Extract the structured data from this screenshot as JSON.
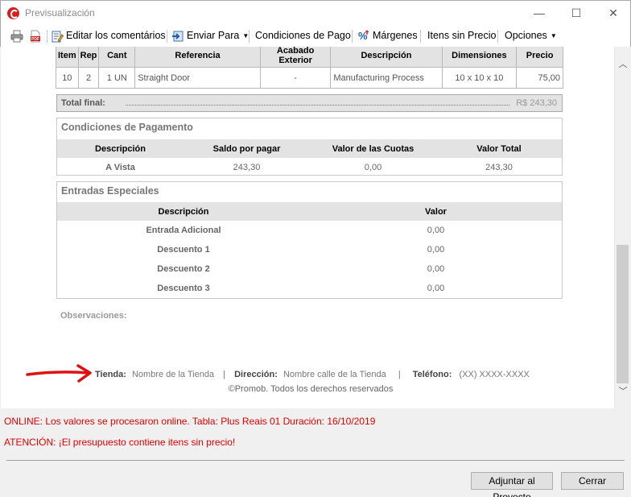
{
  "window": {
    "title": "Previsualización",
    "minimize": "—",
    "maximize": "☐",
    "close": "✕"
  },
  "toolbar": {
    "edit_comments": "Editar los comentários",
    "send_to": "Enviar Para",
    "payment_conditions": "Condiciones de Pago",
    "margins": "Márgenes",
    "items_no_price": "Itens sin Precio",
    "options": "Opciones"
  },
  "items_table": {
    "headers": [
      "Item",
      "Rep",
      "Cant",
      "Referencia",
      "Acabado Exterior",
      "Descripción",
      "Dimensiones",
      "Precio"
    ],
    "rows": [
      [
        "10",
        "2",
        "1 UN",
        "Straight Door",
        "-",
        "Manufacturing Process",
        "10 x 10 x 10",
        "75,00"
      ]
    ]
  },
  "total": {
    "label": "Total final:",
    "value": "R$ 243,30"
  },
  "payment": {
    "title": "Condiciones de Pagamento",
    "headers": [
      "Descripción",
      "Saldo por pagar",
      "Valor de las Cuotas",
      "Valor Total"
    ],
    "rows": [
      [
        "A Vista",
        "243,30",
        "0,00",
        "243,30"
      ]
    ]
  },
  "special_entries": {
    "title": "Entradas Especiales",
    "headers": [
      "Descripción",
      "Valor"
    ],
    "rows": [
      [
        "Entrada Adicional",
        "0,00"
      ],
      [
        "Descuento 1",
        "0,00"
      ],
      [
        "Descuento 2",
        "0,00"
      ],
      [
        "Descuento 3",
        "0,00"
      ]
    ]
  },
  "observations_label": "Observaciones:",
  "footer": {
    "store_label": "Tienda:",
    "store_value": "Nombre de la Tienda",
    "sep": "|",
    "address_label": "Dirección:",
    "address_value": "Nombre calle de la Tienda",
    "phone_label": "Teléfono:",
    "phone_value": "(XX) XXXX-XXXX",
    "copyright": "©Promob. Todos los derechos reservados"
  },
  "status": {
    "online": "ONLINE: Los valores se procesaron online. Tabla: Plus Reais 01 Duración: 16/10/2019",
    "warning": "ATENCIÓN: ¡El presupuesto contiene itens sin precio!",
    "color": "#e00000"
  },
  "buttons": {
    "attach": "Adjuntar al Proyecto",
    "close": "Cerrar"
  },
  "scroll": {
    "up": "︿",
    "down": "﹀"
  }
}
